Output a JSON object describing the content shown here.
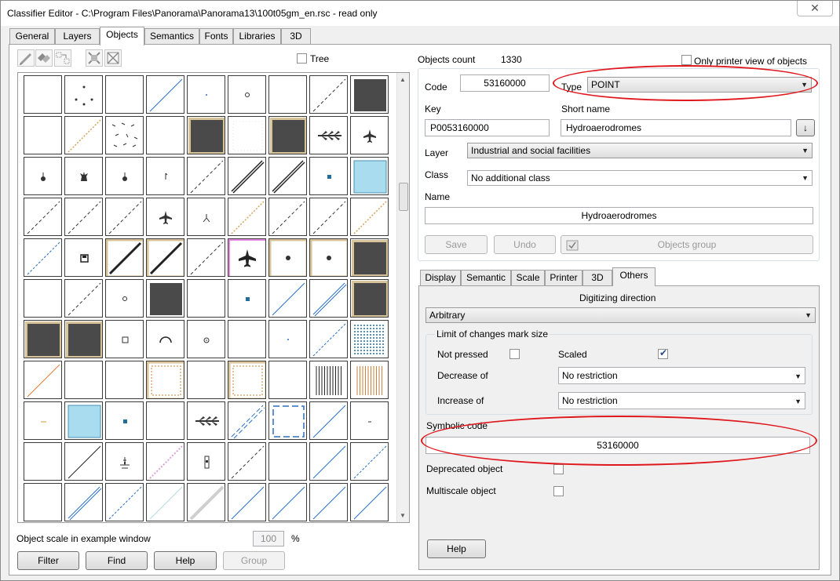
{
  "window": {
    "title": "Classifier Editor - C:\\Program Files\\Panorama\\Panorama13\\100t05gm_en.rsc - read only",
    "close_glyph": "✕"
  },
  "tabs": [
    {
      "label": "General"
    },
    {
      "label": "Layers"
    },
    {
      "label": "Objects"
    },
    {
      "label": "Semantics"
    },
    {
      "label": "Fonts"
    },
    {
      "label": "Libraries"
    },
    {
      "label": "3D"
    }
  ],
  "objects_panel": {
    "tree_label": "Tree",
    "tree_checked": false,
    "scale_label": "Object scale in example window",
    "scale_value": "100",
    "scale_unit": "%",
    "buttons": {
      "filter": "Filter",
      "find": "Find",
      "help": "Help",
      "group": "Group"
    },
    "toolbar_icons": [
      "pencil-edit-icon",
      "duplicate-icon",
      "move-objects-icon",
      "cut-icon",
      "delete-icon"
    ]
  },
  "details": {
    "objects_count_label": "Objects count",
    "objects_count_value": "1330",
    "only_printer_label": "Only printer view of objects",
    "only_printer_checked": false,
    "code_label": "Code",
    "code_value": "53160000",
    "type_label": "Type",
    "type_value": "POINT",
    "key_label": "Key",
    "key_value": "P0053160000",
    "short_name_label": "Short name",
    "short_name_value": "Hydroaerodromes",
    "layer_label": "Layer",
    "layer_value": "Industrial and social facilities",
    "class_label": "Class",
    "class_value": "No additional class",
    "name_label": "Name",
    "name_value": "Hydroaerodromes",
    "save_label": "Save",
    "undo_label": "Undo",
    "objects_group_label": "Objects group"
  },
  "subtabs": [
    {
      "label": "Display"
    },
    {
      "label": "Semantic"
    },
    {
      "label": "Scale"
    },
    {
      "label": "Printer"
    },
    {
      "label": "3D"
    },
    {
      "label": "Others"
    }
  ],
  "others": {
    "digitizing_label": "Digitizing direction",
    "digitizing_value": "Arbitrary",
    "limit_group_label": "Limit of changes mark size",
    "not_pressed_label": "Not pressed",
    "not_pressed_checked": false,
    "scaled_label": "Scaled",
    "scaled_checked": true,
    "decrease_label": "Decrease of",
    "decrease_value": "No restriction",
    "increase_label": "Increase of",
    "increase_value": "No restriction",
    "symbolic_code_label": "Symbolic code",
    "symbolic_code_value": "53160000",
    "deprecated_label": "Deprecated object",
    "deprecated_checked": false,
    "multiscale_label": "Multiscale object",
    "multiscale_checked": false,
    "help_label": "Help"
  },
  "colors": {
    "highlight_red": "#e0181d",
    "dark_fill": "#4a4a4a",
    "light_blue_fill": "#aadcef",
    "tan_border": "#d8c49a",
    "line_blue": "#2a6fbf"
  },
  "grid": {
    "rows": 11,
    "cols": 9,
    "cells": [
      "empty",
      "dots4",
      "empty",
      "diag-blue",
      "dot-tiny",
      "circle-small",
      "empty",
      "diag-dash-dark",
      "dark-square",
      "empty",
      "diag-tan-dots",
      "scatter-dashes",
      "empty",
      "dark-square-tan",
      "empty-dotted",
      "dark-square-tan",
      "wheat-symbol",
      "airplane-small",
      "lamp-symbol",
      "tower-symbol",
      "lamp-symbol",
      "flag-tiny",
      "diag-dash-dark",
      "diag-double",
      "diag-double",
      "square-blue-small",
      "lightblue-square",
      "diag-dash-dark",
      "diag-dash-dark",
      "diag-dash-dark",
      "airplane-small",
      "fork-symbol",
      "diag-tan-dots",
      "diag-dash-dark",
      "diag-dash-dark",
      "diag-tan-dots",
      "diag-dash-blue",
      "disk-symbol",
      "diag-double-tan",
      "diag-double-tan",
      "diag-dash-dark",
      "airplane-black-pink",
      "dot-tan",
      "dot-tan",
      "dark-square-tan",
      "empty",
      "diag-dash-dark",
      "circle-small",
      "dark-square",
      "empty",
      "square-blue-small",
      "diag-blue",
      "diag-double-blue",
      "dark-square-tan",
      "dark-square-tan",
      "dark-square-tan",
      "square-outline-small",
      "arc-symbol",
      "circle-dot-symbol",
      "empty",
      "dot-tiny",
      "diag-dash-blue",
      "hatch-blue",
      "diag-orange",
      "empty",
      "empty",
      "tan-dotted-square",
      "empty",
      "tan-dotted-square",
      "empty",
      "vertical-lines-black",
      "vertical-lines-tan",
      "dash-tan-short",
      "lightblue-square",
      "square-blue-small",
      "empty",
      "wheat-symbol",
      "diag-double-dash-blue",
      "dashed-square-blue",
      "diag-blue",
      "dash-short",
      "empty",
      "diag-dark",
      "antenna-symbol",
      "diag-pink-dots",
      "signal-symbol",
      "diag-dash-dark",
      "empty",
      "diag-blue",
      "diag-dash-blue",
      "empty",
      "diag-double-blue",
      "diag-dash-blue",
      "diag-light",
      "diag-gray-thick",
      "diag-blue",
      "diag-blue",
      "diag-blue",
      "diag-blue"
    ],
    "highlighted_cell": 41
  }
}
